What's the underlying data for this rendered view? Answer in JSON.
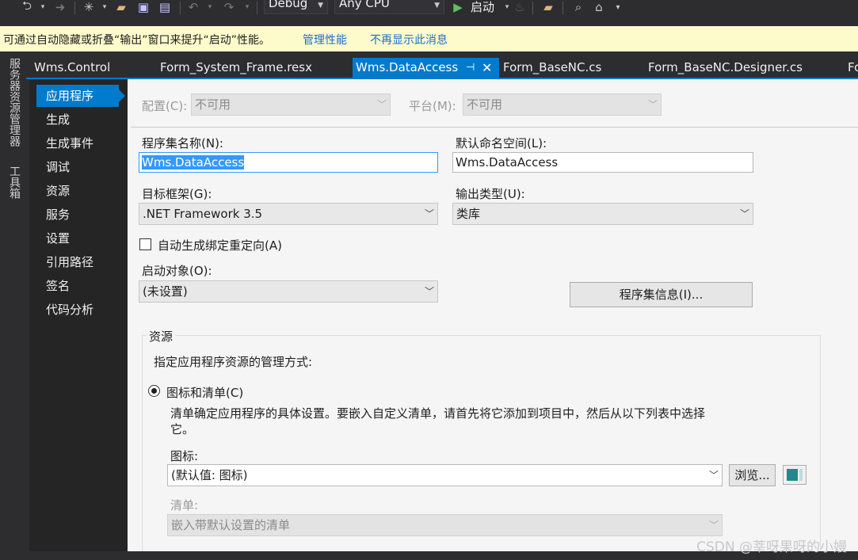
{
  "toolbar": {
    "config": "Debug",
    "platform": "Any CPU",
    "start": "启动"
  },
  "infobar": {
    "message": "可通过自动隐藏或折叠“输出”窗口来提升“启动”性能。",
    "link_manage": "管理性能",
    "link_dismiss": "不再显示此消息"
  },
  "side_tabs": {
    "server_explorer": "服务器资源管理器",
    "toolbox": "工具箱"
  },
  "doc_tabs": [
    {
      "label": "Wms.Control"
    },
    {
      "label": "Form_System_Frame.resx"
    },
    {
      "label": "Wms.DataAccess"
    },
    {
      "label": "Form_BaseNC.cs"
    },
    {
      "label": "Form_BaseNC.Designer.cs"
    },
    {
      "label": "Fo"
    }
  ],
  "nav": [
    {
      "label": "应用程序"
    },
    {
      "label": "生成"
    },
    {
      "label": "生成事件"
    },
    {
      "label": "调试"
    },
    {
      "label": "资源"
    },
    {
      "label": "服务"
    },
    {
      "label": "设置"
    },
    {
      "label": "引用路径"
    },
    {
      "label": "签名"
    },
    {
      "label": "代码分析"
    }
  ],
  "app": {
    "config_label": "配置(C):",
    "config_value": "不可用",
    "platform_label": "平台(M):",
    "platform_value": "不可用",
    "assembly_name_label": "程序集名称(N):",
    "assembly_name": "Wms.DataAccess",
    "namespace_label": "默认命名空间(L):",
    "namespace": "Wms.DataAccess",
    "framework_label": "目标框架(G):",
    "framework": ".NET Framework 3.5",
    "output_type_label": "输出类型(U):",
    "output_type": "类库",
    "auto_binding_label": "自动生成绑定重定向(A)",
    "startup_label": "启动对象(O):",
    "startup": "(未设置)",
    "assembly_info_button": "程序集信息(I)..."
  },
  "resources": {
    "group_title": "资源",
    "instruction": "指定应用程序资源的管理方式:",
    "radio_icon_manifest": "图标和清单(C)",
    "desc_line1": "清单确定应用程序的具体设置。要嵌入自定义清单，请首先将它添加到项目中，然后从以下列表中选择",
    "desc_line2": "它。",
    "icon_label": "图标:",
    "icon_value": "(默认值: 图标)",
    "browse_button": "浏览...",
    "manifest_label": "清单:",
    "manifest_value": "嵌入带默认设置的清单"
  },
  "watermark": "CSDN @莘呀果呀的小嫚"
}
